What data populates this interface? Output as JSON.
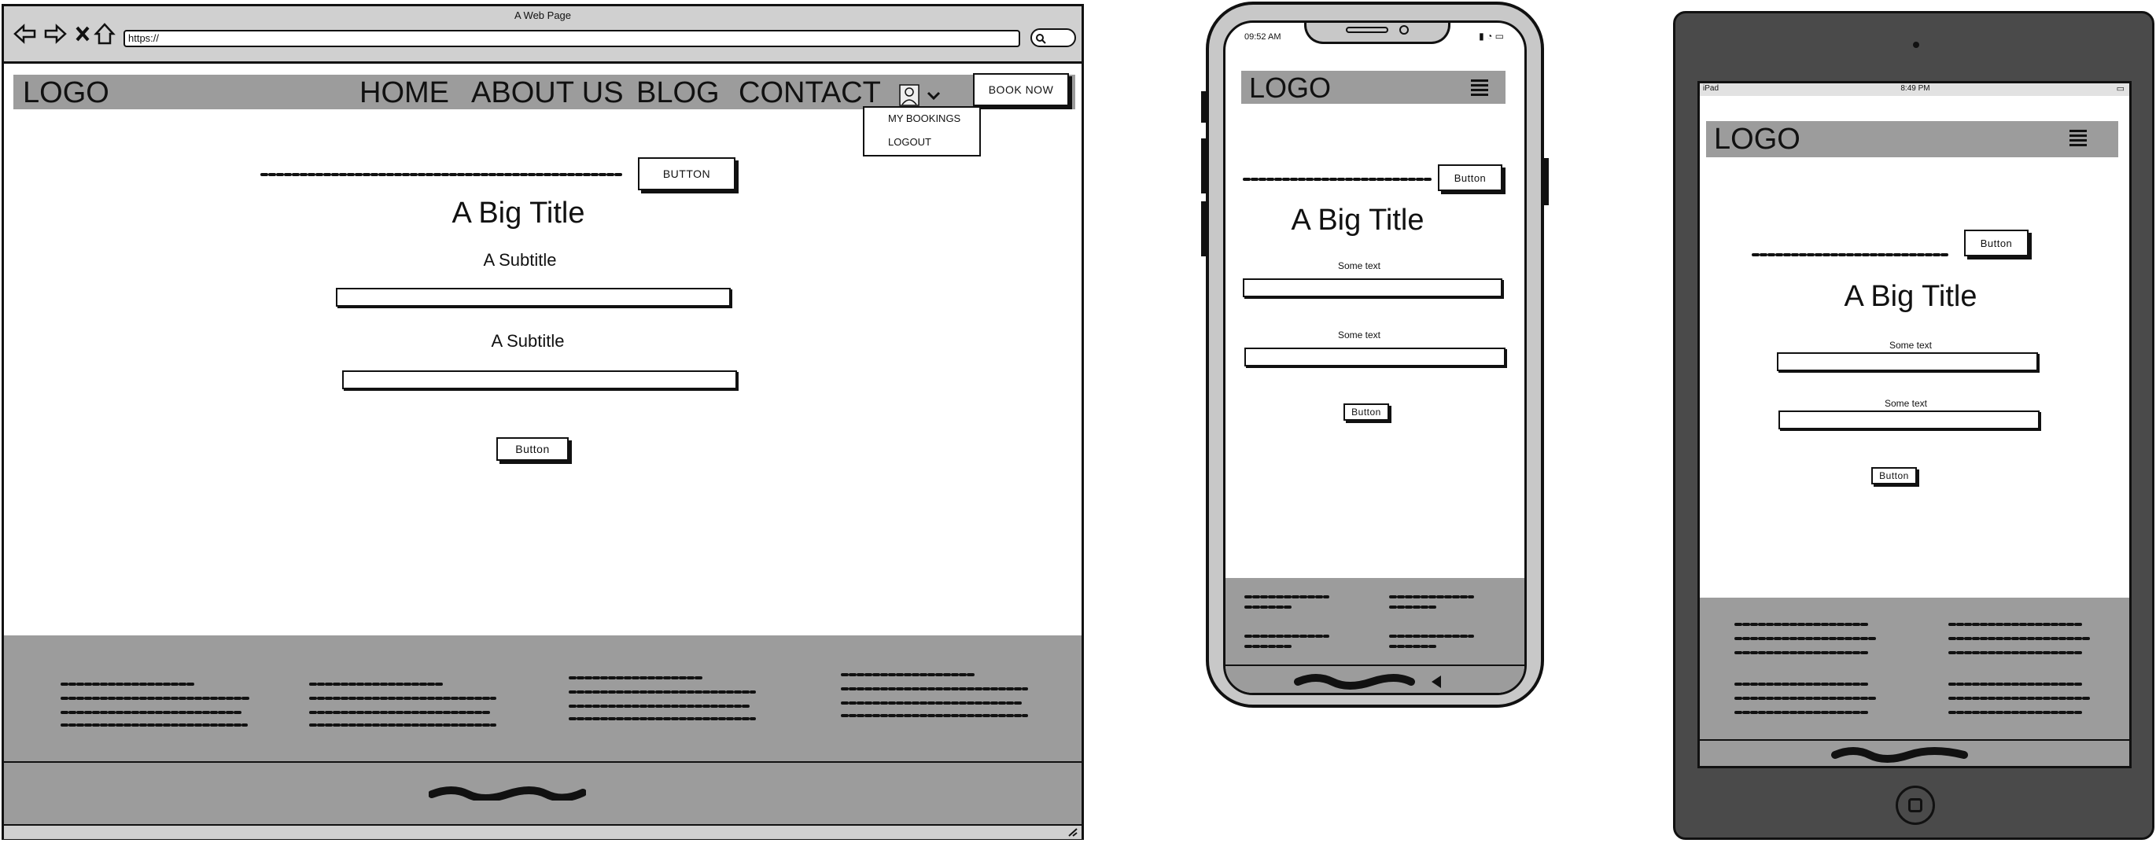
{
  "desktop": {
    "window_title": "A Web Page",
    "url": "https://",
    "logo": "LOGO",
    "nav": [
      "HOME",
      "ABOUT US",
      "BLOG",
      "CONTACT"
    ],
    "book_now": "BOOK NOW",
    "dropdown": [
      "MY BOOKINGS",
      "LOGOUT"
    ],
    "hero_button": "BUTTON",
    "title": "A Big Title",
    "subtitle_1": "A Subtitle",
    "subtitle_2": "A Subtitle",
    "submit_button": "Button"
  },
  "phone": {
    "time": "09:52 AM",
    "logo": "LOGO",
    "hero_button": "Button",
    "title": "A Big Title",
    "label_1": "Some text",
    "label_2": "Some text",
    "submit_button": "Button"
  },
  "tablet": {
    "carrier": "iPad",
    "time": "8:49 PM",
    "logo": "LOGO",
    "hero_button": "Button",
    "title": "A Big Title",
    "label_1": "Some text",
    "label_2": "Some text",
    "submit_button": "Button"
  },
  "colors": {
    "bar_grey": "#9c9c9c",
    "frame_dark": "#4a4a4a",
    "phone_frame": "#c8c8c8"
  }
}
